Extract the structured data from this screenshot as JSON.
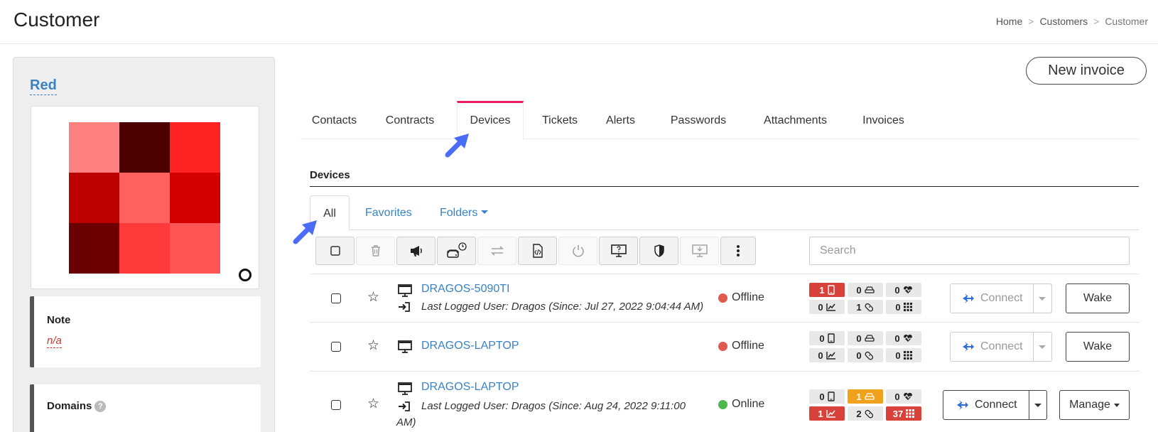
{
  "page": {
    "title": "Customer"
  },
  "breadcrumb": {
    "home": "Home",
    "customers": "Customers",
    "current": "Customer",
    "sep": ">"
  },
  "customer": {
    "name": "Red",
    "avatar_colors": [
      "#ff8080",
      "#4d0000",
      "#ff2222",
      "#bb0000",
      "#ff6060",
      "#d40000",
      "#6b0000",
      "#ff3a3a",
      "#ff5555"
    ]
  },
  "note": {
    "title": "Note",
    "value": "n/a"
  },
  "domains": {
    "title": "Domains",
    "help": "?"
  },
  "actions": {
    "new_invoice": "New invoice"
  },
  "tabs": [
    "Contacts",
    "Contracts",
    "Devices",
    "Tickets",
    "Alerts",
    "Passwords",
    "Attachments",
    "Invoices"
  ],
  "active_tab": "Devices",
  "devices": {
    "section_title": "Devices",
    "subtabs": {
      "all": "All",
      "favorites": "Favorites",
      "folders": "Folders"
    },
    "search_placeholder": "Search",
    "toolbar_icons": [
      "checkbox-icon",
      "trash-icon",
      "megaphone-icon",
      "drive-clock-icon",
      "transfer-icon",
      "script-icon",
      "power-icon",
      "remote-screen-icon",
      "shield-icon",
      "download-screen-icon",
      "more-vertical-icon"
    ],
    "rows": [
      {
        "name": "DRAGOS-5090TI",
        "last_user": "Last Logged User: Dragos (Since: Jul 27, 2022 9:04:44 AM)",
        "status": "Offline",
        "badges": {
          "mobile": "1",
          "disk": "0",
          "health": "0",
          "perf": "0",
          "patches": "1",
          "apps": "0"
        },
        "connect": "Connect",
        "action": "Wake"
      },
      {
        "name": "DRAGOS-LAPTOP",
        "last_user": "",
        "status": "Offline",
        "badges": {
          "mobile": "0",
          "disk": "0",
          "health": "0",
          "perf": "0",
          "patches": "0",
          "apps": "0"
        },
        "connect": "Connect",
        "action": "Wake"
      },
      {
        "name": "DRAGOS-LAPTOP",
        "last_user_1": "Last Logged User: Dragos (Since: Aug 24, 2022 9:11:00",
        "last_user_2": "AM)",
        "status": "Online",
        "badges": {
          "mobile": "0",
          "disk": "1",
          "health": "0",
          "perf": "1",
          "patches": "2",
          "apps": "37"
        },
        "connect": "Connect",
        "action": "Manage"
      }
    ]
  },
  "colors": {
    "link": "#3a82c4",
    "active_tab": "#e91e63",
    "offline": "#e05a4f",
    "online": "#4cb84c",
    "badge_red": "#d9423a",
    "badge_orange": "#f0a21c",
    "arrow": "#4a6cf7"
  }
}
